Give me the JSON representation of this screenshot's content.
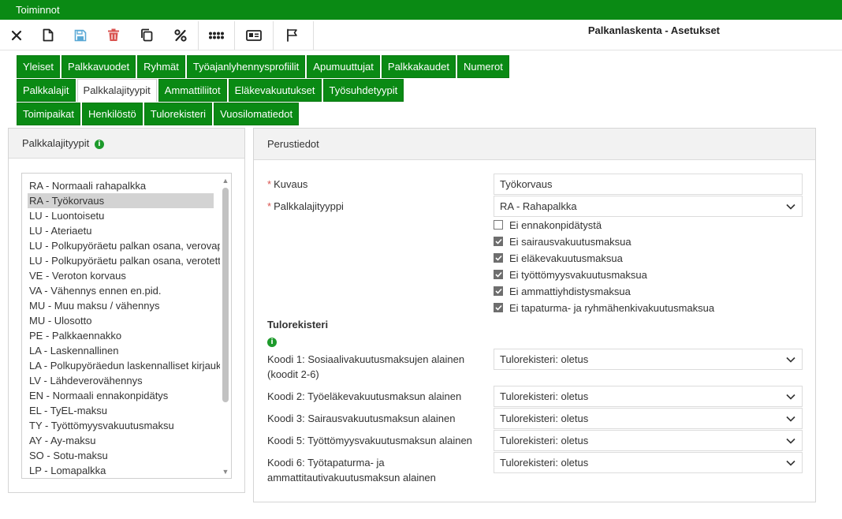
{
  "topbar": {
    "title": "Toiminnot"
  },
  "toolbar": {
    "page_title": "Palkanlaskenta - Asetukset",
    "icons": [
      "close-icon",
      "new-document-icon",
      "save-icon",
      "delete-icon",
      "copy-icon",
      "percent-icon",
      "apps-icon",
      "id-card-icon",
      "flag-icon"
    ]
  },
  "tabs": {
    "row1": [
      "Yleiset",
      "Palkkavuodet",
      "Ryhmät",
      "Työajanlyhennysprofiilit",
      "Apumuuttujat",
      "Palkkakaudet",
      "Numerot"
    ],
    "row2": [
      "Palkkalajit",
      "Palkkalajityypit",
      "Ammattiliitot",
      "Eläkevakuutukset",
      "Työsuhdetyypit"
    ],
    "row3": [
      "Toimipaikat",
      "Henkilöstö",
      "Tulorekisteri",
      "Vuosilomatiedot"
    ],
    "active": "Palkkalajityypit"
  },
  "left_panel": {
    "title": "Palkkalajityypit",
    "items": [
      "RA - Normaali rahapalkka",
      "RA - Työkorvaus",
      "LU - Luontoisetu",
      "LU - Ateriaetu",
      "LU - Polkupyöräetu palkan osana, verovapaa",
      "LU - Polkupyöräetu palkan osana, verotettava",
      "VE - Veroton korvaus",
      "VA - Vähennys ennen en.pid.",
      "MU - Muu maksu / vähennys",
      "MU - Ulosotto",
      "PE - Palkkaennakko",
      "LA - Laskennallinen",
      "LA - Polkupyöräedun laskennalliset kirjaukset",
      "LV - Lähdeverovähennys",
      "EN - Normaali ennakonpidätys",
      "EL - TyEL-maksu",
      "TY - Työttömyysvakuutusmaksu",
      "AY - Ay-maksu",
      "SO - Sotu-maksu",
      "LP - Lomapalkka"
    ],
    "selected_index": 1
  },
  "right_panel": {
    "title": "Perustiedot",
    "kuvaus_label": "Kuvaus",
    "kuvaus_value": "Työkorvaus",
    "tyyppi_label": "Palkkalajityyppi",
    "tyyppi_value": "RA - Rahapalkka",
    "checkboxes": [
      {
        "label": "Ei ennakonpidätystä",
        "checked": false
      },
      {
        "label": "Ei sairausvakuutusmaksua",
        "checked": true
      },
      {
        "label": "Ei eläkevakuutusmaksua",
        "checked": true
      },
      {
        "label": "Ei työttömyysvakuutusmaksua",
        "checked": true
      },
      {
        "label": "Ei ammattiyhdistysmaksua",
        "checked": true
      },
      {
        "label": "Ei tapaturma- ja ryhmähenkivakuutusmaksua",
        "checked": true
      }
    ],
    "tulorekisteri_title": "Tulorekisteri",
    "codes": [
      {
        "label_line1": "Koodi 1: Sosiaalivakuutusmaksujen alainen",
        "label_line2": "(koodit 2-6)",
        "value": "Tulorekisteri: oletus"
      },
      {
        "label_line1": "Koodi 2: Työeläkevakuutusmaksun alainen",
        "label_line2": "",
        "value": "Tulorekisteri: oletus"
      },
      {
        "label_line1": "Koodi 3: Sairausvakuutusmaksun alainen",
        "label_line2": "",
        "value": "Tulorekisteri: oletus"
      },
      {
        "label_line1": "Koodi 5: Työttömyysvakuutusmaksun alainen",
        "label_line2": "",
        "value": "Tulorekisteri: oletus"
      },
      {
        "label_line1": "Koodi 6: Työtapaturma- ja",
        "label_line2": "ammattitautivakuutusmaksun alainen",
        "value": "Tulorekisteri: oletus"
      }
    ]
  },
  "colors": {
    "brand_green": "#0a8a14",
    "info_green": "#1d9a2b",
    "required_red": "#d9534f",
    "delete_red": "#d9534f",
    "save_blue": "#5aa9d6"
  }
}
